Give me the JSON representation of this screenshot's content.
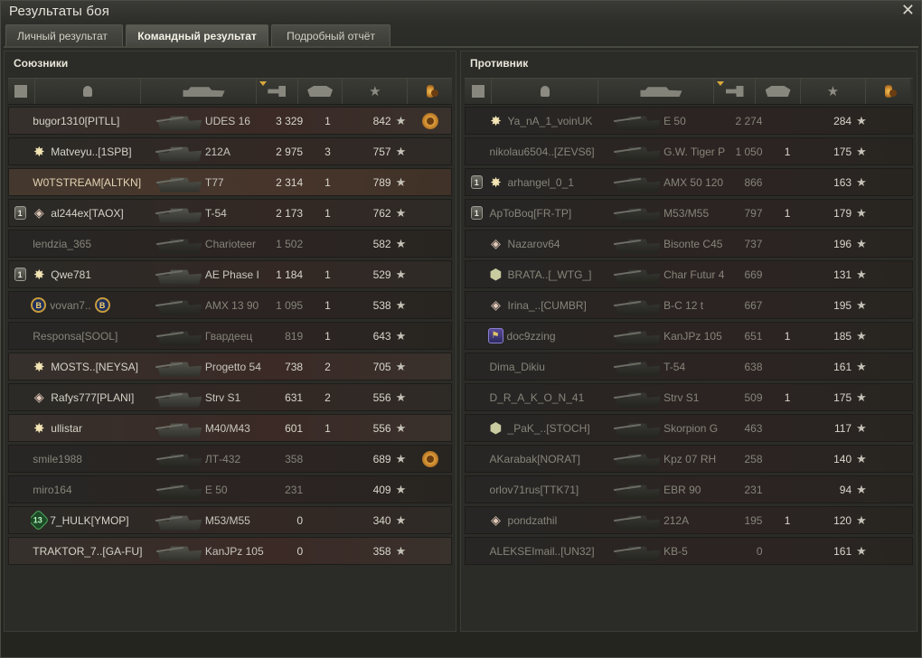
{
  "window": {
    "title": "Результаты боя",
    "close_glyph": "✕"
  },
  "tabs": [
    {
      "label": "Личный результат",
      "active": false
    },
    {
      "label": "Командный результат",
      "active": true
    },
    {
      "label": "Подробный отчёт",
      "active": false
    }
  ],
  "star_glyph": "★",
  "allies": {
    "title": "Союзники",
    "rows": [
      {
        "platoon": "",
        "badge": "",
        "name": "bugor1310[PITLL]",
        "tank": "UDES 16",
        "damage": "3 329",
        "kills": "1",
        "xp": "842",
        "medal": true,
        "alive": true,
        "me": false
      },
      {
        "platoon": "",
        "badge": "star",
        "name": "Matveyu..[1SPB]",
        "tank": "212A",
        "damage": "2 975",
        "kills": "3",
        "xp": "757",
        "medal": false,
        "alive": true,
        "me": false
      },
      {
        "platoon": "",
        "badge": "",
        "name": "W0TSTREAM[ALTKN]",
        "tank": "T77",
        "damage": "2 314",
        "kills": "1",
        "xp": "789",
        "medal": false,
        "alive": true,
        "me": true
      },
      {
        "platoon": "1",
        "badge": "rhomb",
        "name": "al244ex[TAOX]",
        "tank": "T-54",
        "damage": "2 173",
        "kills": "1",
        "xp": "762",
        "medal": false,
        "alive": true,
        "me": false
      },
      {
        "platoon": "",
        "badge": "",
        "name": "lendzia_365",
        "tank": "Charioteer",
        "damage": "1 502",
        "kills": "",
        "xp": "582",
        "medal": false,
        "alive": false,
        "me": false
      },
      {
        "platoon": "1",
        "badge": "star",
        "name": "Qwe781",
        "tank": "AE Phase I",
        "damage": "1 184",
        "kills": "1",
        "xp": "529",
        "medal": false,
        "alive": true,
        "me": false
      },
      {
        "platoon": "",
        "badge": "b",
        "name": "vovan7..",
        "tank": "AMX 13 90",
        "damage": "1 095",
        "kills": "1",
        "xp": "538",
        "medal": false,
        "alive": false,
        "me": false
      },
      {
        "platoon": "",
        "badge": "",
        "name": "Responsa[SOOL]",
        "tank": "Гвардеец",
        "damage": "819",
        "kills": "1",
        "xp": "643",
        "medal": false,
        "alive": false,
        "me": false
      },
      {
        "platoon": "",
        "badge": "star",
        "name": "MOSTS..[NEYSA]",
        "tank": "Progetto 54",
        "damage": "738",
        "kills": "2",
        "xp": "705",
        "medal": false,
        "alive": true,
        "me": false
      },
      {
        "platoon": "",
        "badge": "rhomb",
        "name": "Rafys777[PLANI]",
        "tank": "Strv S1",
        "damage": "631",
        "kills": "2",
        "xp": "556",
        "medal": false,
        "alive": true,
        "me": false
      },
      {
        "platoon": "",
        "badge": "star",
        "name": "ullistar",
        "tank": "M40/M43",
        "damage": "601",
        "kills": "1",
        "xp": "556",
        "medal": false,
        "alive": true,
        "me": false
      },
      {
        "platoon": "",
        "badge": "",
        "name": "smile1988",
        "tank": "ЛТ-432",
        "damage": "358",
        "kills": "",
        "xp": "689",
        "medal": true,
        "alive": false,
        "me": false
      },
      {
        "platoon": "",
        "badge": "",
        "name": "miro164",
        "tank": "E 50",
        "damage": "231",
        "kills": "",
        "xp": "409",
        "medal": false,
        "alive": false,
        "me": false
      },
      {
        "platoon": "",
        "badge": "num13",
        "name": "7_HULK[YMOP]",
        "tank": "M53/M55",
        "damage": "0",
        "kills": "",
        "xp": "340",
        "medal": false,
        "alive": true,
        "me": false
      },
      {
        "platoon": "",
        "badge": "",
        "name": "TRAKTOR_7..[GA-FU]",
        "tank": "KanJPz 105",
        "damage": "0",
        "kills": "",
        "xp": "358",
        "medal": false,
        "alive": true,
        "me": false
      }
    ]
  },
  "enemies": {
    "title": "Противник",
    "rows": [
      {
        "platoon": "",
        "badge": "star",
        "name": "Ya_nA_1_voinUK",
        "tank": "E 50",
        "damage": "2 274",
        "kills": "",
        "xp": "284",
        "medal": false,
        "alive": false,
        "me": false
      },
      {
        "platoon": "",
        "badge": "",
        "name": "nikolau6504..[ZEVS6]",
        "tank": "G.W. Tiger P",
        "damage": "1 050",
        "kills": "1",
        "xp": "175",
        "medal": false,
        "alive": false,
        "me": false
      },
      {
        "platoon": "1",
        "badge": "star",
        "name": "arhangel_0_1",
        "tank": "AMX 50 120",
        "damage": "866",
        "kills": "",
        "xp": "163",
        "medal": false,
        "alive": false,
        "me": false
      },
      {
        "platoon": "1",
        "badge": "",
        "name": "ApToBoq[FR-TP]",
        "tank": "M53/M55",
        "damage": "797",
        "kills": "1",
        "xp": "179",
        "medal": false,
        "alive": false,
        "me": false
      },
      {
        "platoon": "",
        "badge": "rhomb",
        "name": "Nazarov64",
        "tank": "Bisonte C45",
        "damage": "737",
        "kills": "",
        "xp": "196",
        "medal": false,
        "alive": false,
        "me": false
      },
      {
        "platoon": "",
        "badge": "hex",
        "name": "BRATA..[_WTG_]",
        "tank": "Char Futur 4",
        "damage": "669",
        "kills": "",
        "xp": "131",
        "medal": false,
        "alive": false,
        "me": false
      },
      {
        "platoon": "",
        "badge": "rhomb",
        "name": "Irina_..[CUMBR]",
        "tank": "B-C 12 t",
        "damage": "667",
        "kills": "",
        "xp": "195",
        "medal": false,
        "alive": false,
        "me": false
      },
      {
        "platoon": "",
        "badge": "purple",
        "name": "doc9zzing",
        "tank": "KanJPz 105",
        "damage": "651",
        "kills": "1",
        "xp": "185",
        "medal": false,
        "alive": false,
        "me": false
      },
      {
        "platoon": "",
        "badge": "",
        "name": "Dima_Dikiu",
        "tank": "T-54",
        "damage": "638",
        "kills": "",
        "xp": "161",
        "medal": false,
        "alive": false,
        "me": false
      },
      {
        "platoon": "",
        "badge": "",
        "name": "D_R_A_K_O_N_41",
        "tank": "Strv S1",
        "damage": "509",
        "kills": "1",
        "xp": "175",
        "medal": false,
        "alive": false,
        "me": false
      },
      {
        "platoon": "",
        "badge": "hex",
        "name": "_PaK_..[STOCH]",
        "tank": "Skorpion G",
        "damage": "463",
        "kills": "",
        "xp": "117",
        "medal": false,
        "alive": false,
        "me": false
      },
      {
        "platoon": "",
        "badge": "",
        "name": "AKarabak[NORAT]",
        "tank": "Kpz 07 RH",
        "damage": "258",
        "kills": "",
        "xp": "140",
        "medal": false,
        "alive": false,
        "me": false
      },
      {
        "platoon": "",
        "badge": "",
        "name": "orlov71rus[TTK71]",
        "tank": "EBR 90",
        "damage": "231",
        "kills": "",
        "xp": "94",
        "medal": false,
        "alive": false,
        "me": false
      },
      {
        "platoon": "",
        "badge": "rhomb",
        "name": "pondzathil",
        "tank": "212A",
        "damage": "195",
        "kills": "1",
        "xp": "120",
        "medal": false,
        "alive": false,
        "me": false
      },
      {
        "platoon": "",
        "badge": "",
        "name": "ALEKSEImail..[UN32]",
        "tank": "KB-5",
        "damage": "0",
        "kills": "",
        "xp": "161",
        "medal": false,
        "alive": false,
        "me": false
      }
    ]
  },
  "header_icons": [
    "platoon-icon",
    "player-icon",
    "tank-icon",
    "damage-icon",
    "kills-icon",
    "xp-star-icon",
    "medal-icon"
  ],
  "colors": {
    "medal": "#e0a53a",
    "sort_marker": "#d7a83a"
  }
}
